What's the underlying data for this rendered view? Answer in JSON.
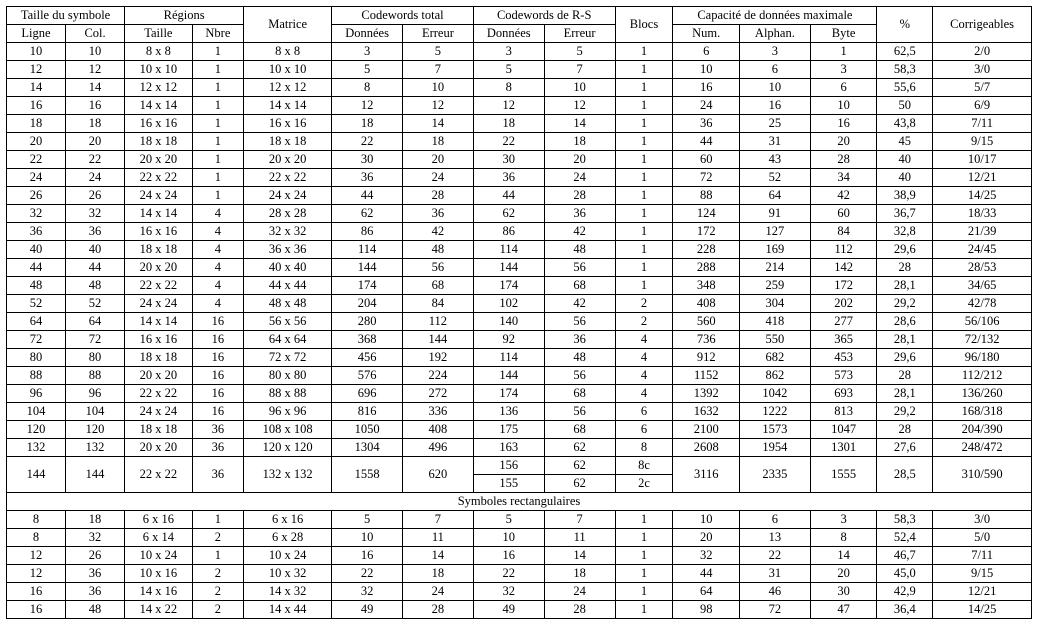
{
  "headers": {
    "taille_symbole": "Taille du symbole",
    "ligne": "Ligne",
    "col": "Col.",
    "regions": "Régions",
    "taille": "Taille",
    "nbre": "Nbre",
    "matrice": "Matrice",
    "codewords_total": "Codewords total",
    "donnees": "Données",
    "erreur": "Erreur",
    "codewords_rs": "Codewords de R-S",
    "blocs": "Blocs",
    "capacite": "Capacité de données maximale",
    "num": "Num.",
    "alphan": "Alphan.",
    "byte": "Byte",
    "pct": "%",
    "corrigeables": "Corrigeables",
    "rect": "Symboles rectangulaires"
  },
  "rows": [
    {
      "ligne": "10",
      "col": "10",
      "rtaille": "8 x 8",
      "rnbre": "1",
      "matrice": "8 x 8",
      "cwt_d": "3",
      "cwt_e": "5",
      "cwr_d": "3",
      "cwr_e": "5",
      "blocs": "1",
      "num": "6",
      "alph": "3",
      "byte": "1",
      "pct": "62,5",
      "corr": "2/0"
    },
    {
      "ligne": "12",
      "col": "12",
      "rtaille": "10 x 10",
      "rnbre": "1",
      "matrice": "10 x 10",
      "cwt_d": "5",
      "cwt_e": "7",
      "cwr_d": "5",
      "cwr_e": "7",
      "blocs": "1",
      "num": "10",
      "alph": "6",
      "byte": "3",
      "pct": "58,3",
      "corr": "3/0"
    },
    {
      "ligne": "14",
      "col": "14",
      "rtaille": "12 x 12",
      "rnbre": "1",
      "matrice": "12 x 12",
      "cwt_d": "8",
      "cwt_e": "10",
      "cwr_d": "8",
      "cwr_e": "10",
      "blocs": "1",
      "num": "16",
      "alph": "10",
      "byte": "6",
      "pct": "55,6",
      "corr": "5/7"
    },
    {
      "ligne": "16",
      "col": "16",
      "rtaille": "14 x 14",
      "rnbre": "1",
      "matrice": "14 x 14",
      "cwt_d": "12",
      "cwt_e": "12",
      "cwr_d": "12",
      "cwr_e": "12",
      "blocs": "1",
      "num": "24",
      "alph": "16",
      "byte": "10",
      "pct": "50",
      "corr": "6/9"
    },
    {
      "ligne": "18",
      "col": "18",
      "rtaille": "16 x 16",
      "rnbre": "1",
      "matrice": "16 x 16",
      "cwt_d": "18",
      "cwt_e": "14",
      "cwr_d": "18",
      "cwr_e": "14",
      "blocs": "1",
      "num": "36",
      "alph": "25",
      "byte": "16",
      "pct": "43,8",
      "corr": "7/11"
    },
    {
      "ligne": "20",
      "col": "20",
      "rtaille": "18 x 18",
      "rnbre": "1",
      "matrice": "18 x 18",
      "cwt_d": "22",
      "cwt_e": "18",
      "cwr_d": "22",
      "cwr_e": "18",
      "blocs": "1",
      "num": "44",
      "alph": "31",
      "byte": "20",
      "pct": "45",
      "corr": "9/15"
    },
    {
      "ligne": "22",
      "col": "22",
      "rtaille": "20 x 20",
      "rnbre": "1",
      "matrice": "20 x 20",
      "cwt_d": "30",
      "cwt_e": "20",
      "cwr_d": "30",
      "cwr_e": "20",
      "blocs": "1",
      "num": "60",
      "alph": "43",
      "byte": "28",
      "pct": "40",
      "corr": "10/17"
    },
    {
      "ligne": "24",
      "col": "24",
      "rtaille": "22 x 22",
      "rnbre": "1",
      "matrice": "22 x 22",
      "cwt_d": "36",
      "cwt_e": "24",
      "cwr_d": "36",
      "cwr_e": "24",
      "blocs": "1",
      "num": "72",
      "alph": "52",
      "byte": "34",
      "pct": "40",
      "corr": "12/21"
    },
    {
      "ligne": "26",
      "col": "26",
      "rtaille": "24 x 24",
      "rnbre": "1",
      "matrice": "24 x 24",
      "cwt_d": "44",
      "cwt_e": "28",
      "cwr_d": "44",
      "cwr_e": "28",
      "blocs": "1",
      "num": "88",
      "alph": "64",
      "byte": "42",
      "pct": "38,9",
      "corr": "14/25"
    },
    {
      "ligne": "32",
      "col": "32",
      "rtaille": "14 x 14",
      "rnbre": "4",
      "matrice": "28 x 28",
      "cwt_d": "62",
      "cwt_e": "36",
      "cwr_d": "62",
      "cwr_e": "36",
      "blocs": "1",
      "num": "124",
      "alph": "91",
      "byte": "60",
      "pct": "36,7",
      "corr": "18/33"
    },
    {
      "ligne": "36",
      "col": "36",
      "rtaille": "16 x 16",
      "rnbre": "4",
      "matrice": "32 x 32",
      "cwt_d": "86",
      "cwt_e": "42",
      "cwr_d": "86",
      "cwr_e": "42",
      "blocs": "1",
      "num": "172",
      "alph": "127",
      "byte": "84",
      "pct": "32,8",
      "corr": "21/39"
    },
    {
      "ligne": "40",
      "col": "40",
      "rtaille": "18 x 18",
      "rnbre": "4",
      "matrice": "36 x 36",
      "cwt_d": "114",
      "cwt_e": "48",
      "cwr_d": "114",
      "cwr_e": "48",
      "blocs": "1",
      "num": "228",
      "alph": "169",
      "byte": "112",
      "pct": "29,6",
      "corr": "24/45"
    },
    {
      "ligne": "44",
      "col": "44",
      "rtaille": "20 x 20",
      "rnbre": "4",
      "matrice": "40 x 40",
      "cwt_d": "144",
      "cwt_e": "56",
      "cwr_d": "144",
      "cwr_e": "56",
      "blocs": "1",
      "num": "288",
      "alph": "214",
      "byte": "142",
      "pct": "28",
      "corr": "28/53"
    },
    {
      "ligne": "48",
      "col": "48",
      "rtaille": "22 x 22",
      "rnbre": "4",
      "matrice": "44 x 44",
      "cwt_d": "174",
      "cwt_e": "68",
      "cwr_d": "174",
      "cwr_e": "68",
      "blocs": "1",
      "num": "348",
      "alph": "259",
      "byte": "172",
      "pct": "28,1",
      "corr": "34/65"
    },
    {
      "ligne": "52",
      "col": "52",
      "rtaille": "24 x 24",
      "rnbre": "4",
      "matrice": "48 x 48",
      "cwt_d": "204",
      "cwt_e": "84",
      "cwr_d": "102",
      "cwr_e": "42",
      "blocs": "2",
      "num": "408",
      "alph": "304",
      "byte": "202",
      "pct": "29,2",
      "corr": "42/78"
    },
    {
      "ligne": "64",
      "col": "64",
      "rtaille": "14 x 14",
      "rnbre": "16",
      "matrice": "56 x 56",
      "cwt_d": "280",
      "cwt_e": "112",
      "cwr_d": "140",
      "cwr_e": "56",
      "blocs": "2",
      "num": "560",
      "alph": "418",
      "byte": "277",
      "pct": "28,6",
      "corr": "56/106"
    },
    {
      "ligne": "72",
      "col": "72",
      "rtaille": "16 x 16",
      "rnbre": "16",
      "matrice": "64 x 64",
      "cwt_d": "368",
      "cwt_e": "144",
      "cwr_d": "92",
      "cwr_e": "36",
      "blocs": "4",
      "num": "736",
      "alph": "550",
      "byte": "365",
      "pct": "28,1",
      "corr": "72/132"
    },
    {
      "ligne": "80",
      "col": "80",
      "rtaille": "18 x 18",
      "rnbre": "16",
      "matrice": "72 x 72",
      "cwt_d": "456",
      "cwt_e": "192",
      "cwr_d": "114",
      "cwr_e": "48",
      "blocs": "4",
      "num": "912",
      "alph": "682",
      "byte": "453",
      "pct": "29,6",
      "corr": "96/180"
    },
    {
      "ligne": "88",
      "col": "88",
      "rtaille": "20 x 20",
      "rnbre": "16",
      "matrice": "80 x 80",
      "cwt_d": "576",
      "cwt_e": "224",
      "cwr_d": "144",
      "cwr_e": "56",
      "blocs": "4",
      "num": "1152",
      "alph": "862",
      "byte": "573",
      "pct": "28",
      "corr": "112/212"
    },
    {
      "ligne": "96",
      "col": "96",
      "rtaille": "22 x 22",
      "rnbre": "16",
      "matrice": "88 x 88",
      "cwt_d": "696",
      "cwt_e": "272",
      "cwr_d": "174",
      "cwr_e": "68",
      "blocs": "4",
      "num": "1392",
      "alph": "1042",
      "byte": "693",
      "pct": "28,1",
      "corr": "136/260"
    },
    {
      "ligne": "104",
      "col": "104",
      "rtaille": "24 x 24",
      "rnbre": "16",
      "matrice": "96 x 96",
      "cwt_d": "816",
      "cwt_e": "336",
      "cwr_d": "136",
      "cwr_e": "56",
      "blocs": "6",
      "num": "1632",
      "alph": "1222",
      "byte": "813",
      "pct": "29,2",
      "corr": "168/318"
    },
    {
      "ligne": "120",
      "col": "120",
      "rtaille": "18 x 18",
      "rnbre": "36",
      "matrice": "108 x 108",
      "cwt_d": "1050",
      "cwt_e": "408",
      "cwr_d": "175",
      "cwr_e": "68",
      "blocs": "6",
      "num": "2100",
      "alph": "1573",
      "byte": "1047",
      "pct": "28",
      "corr": "204/390"
    },
    {
      "ligne": "132",
      "col": "132",
      "rtaille": "20 x 20",
      "rnbre": "36",
      "matrice": "120 x 120",
      "cwt_d": "1304",
      "cwt_e": "496",
      "cwr_d": "163",
      "cwr_e": "62",
      "blocs": "8",
      "num": "2608",
      "alph": "1954",
      "byte": "1301",
      "pct": "27,6",
      "corr": "248/472"
    }
  ],
  "row144": {
    "ligne": "144",
    "col": "144",
    "rtaille": "22 x 22",
    "rnbre": "36",
    "matrice": "132 x 132",
    "cwt_d": "1558",
    "cwt_e": "620",
    "sub": [
      {
        "cwr_d": "156",
        "cwr_e": "62",
        "blocs": "8c"
      },
      {
        "cwr_d": "155",
        "cwr_e": "62",
        "blocs": "2c"
      }
    ],
    "num": "3116",
    "alph": "2335",
    "byte": "1555",
    "pct": "28,5",
    "corr": "310/590"
  },
  "rect_rows": [
    {
      "ligne": "8",
      "col": "18",
      "rtaille": "6 x 16",
      "rnbre": "1",
      "matrice": "6 x 16",
      "cwt_d": "5",
      "cwt_e": "7",
      "cwr_d": "5",
      "cwr_e": "7",
      "blocs": "1",
      "num": "10",
      "alph": "6",
      "byte": "3",
      "pct": "58,3",
      "corr": "3/0"
    },
    {
      "ligne": "8",
      "col": "32",
      "rtaille": "6 x 14",
      "rnbre": "2",
      "matrice": "6 x 28",
      "cwt_d": "10",
      "cwt_e": "11",
      "cwr_d": "10",
      "cwr_e": "11",
      "blocs": "1",
      "num": "20",
      "alph": "13",
      "byte": "8",
      "pct": "52,4",
      "corr": "5/0"
    },
    {
      "ligne": "12",
      "col": "26",
      "rtaille": "10 x 24",
      "rnbre": "1",
      "matrice": "10 x 24",
      "cwt_d": "16",
      "cwt_e": "14",
      "cwr_d": "16",
      "cwr_e": "14",
      "blocs": "1",
      "num": "32",
      "alph": "22",
      "byte": "14",
      "pct": "46,7",
      "corr": "7/11"
    },
    {
      "ligne": "12",
      "col": "36",
      "rtaille": "10 x 16",
      "rnbre": "2",
      "matrice": "10 x 32",
      "cwt_d": "22",
      "cwt_e": "18",
      "cwr_d": "22",
      "cwr_e": "18",
      "blocs": "1",
      "num": "44",
      "alph": "31",
      "byte": "20",
      "pct": "45,0",
      "corr": "9/15"
    },
    {
      "ligne": "16",
      "col": "36",
      "rtaille": "14 x 16",
      "rnbre": "2",
      "matrice": "14 x 32",
      "cwt_d": "32",
      "cwt_e": "24",
      "cwr_d": "32",
      "cwr_e": "24",
      "blocs": "1",
      "num": "64",
      "alph": "46",
      "byte": "30",
      "pct": "42,9",
      "corr": "12/21"
    },
    {
      "ligne": "16",
      "col": "48",
      "rtaille": "14 x 22",
      "rnbre": "2",
      "matrice": "14 x 44",
      "cwt_d": "49",
      "cwt_e": "28",
      "cwr_d": "49",
      "cwr_e": "28",
      "blocs": "1",
      "num": "98",
      "alph": "72",
      "byte": "47",
      "pct": "36,4",
      "corr": "14/25"
    }
  ]
}
